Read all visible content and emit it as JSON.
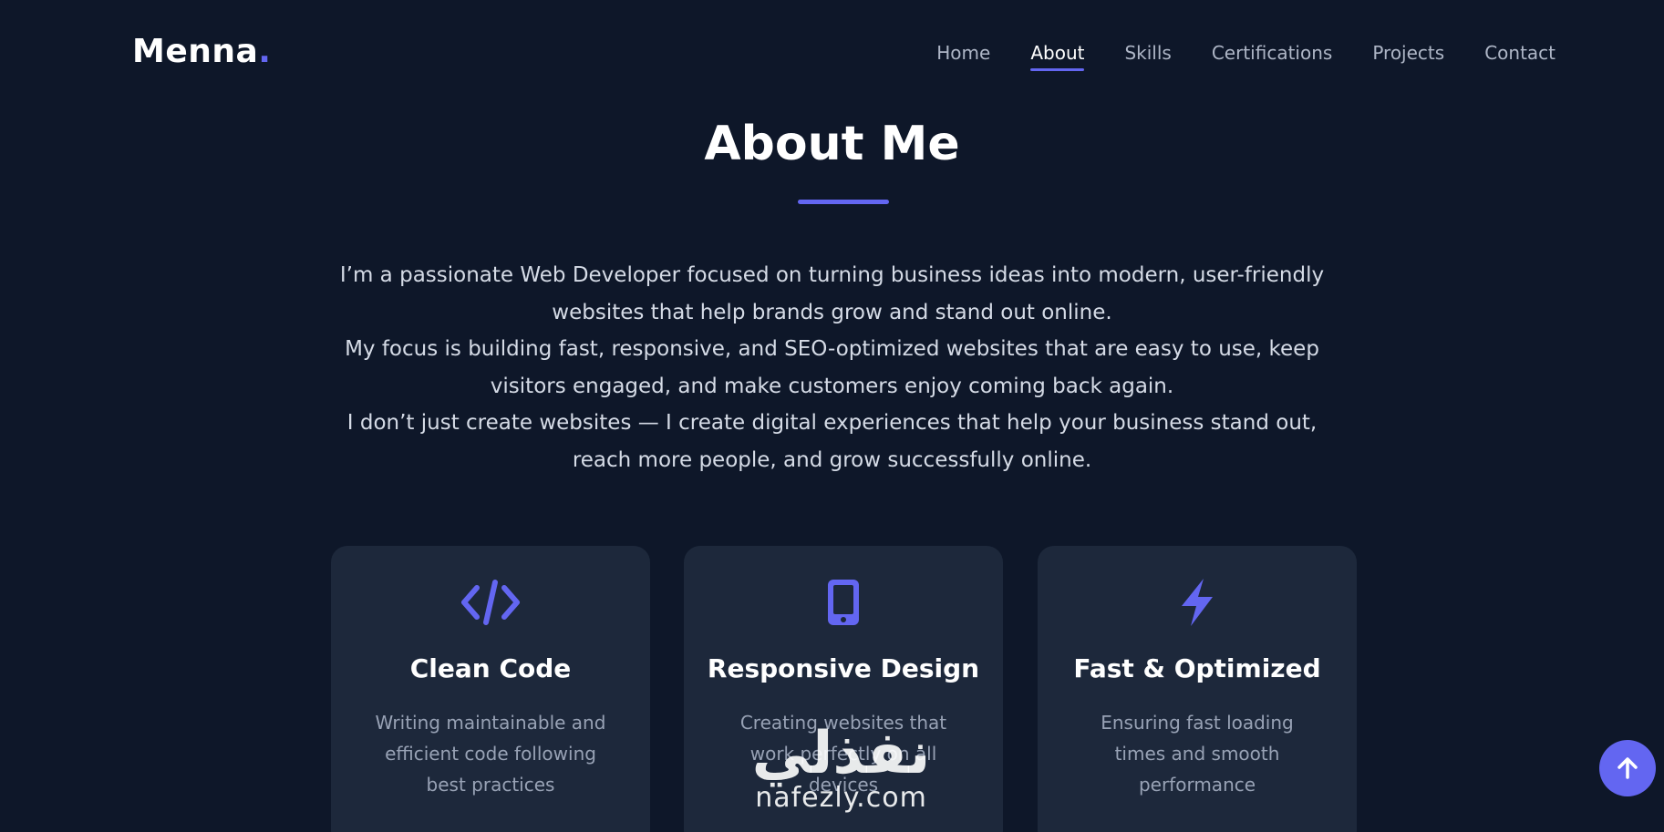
{
  "brand": {
    "name": "Menna",
    "dot": "."
  },
  "nav": {
    "items": [
      {
        "label": "Home",
        "active": false
      },
      {
        "label": "About",
        "active": true
      },
      {
        "label": "Skills",
        "active": false
      },
      {
        "label": "Certifications",
        "active": false
      },
      {
        "label": "Projects",
        "active": false
      },
      {
        "label": "Contact",
        "active": false
      }
    ]
  },
  "about": {
    "title": "About Me",
    "paragraphs": [
      "I’m a passionate Web Developer focused on turning business ideas into modern, user-friendly websites that help brands grow and stand out online.",
      "My focus is building fast, responsive, and SEO-optimized websites that are easy to use, keep visitors engaged, and make customers enjoy coming back again.",
      "I don’t just create websites — I create digital experiences that help your business stand out, reach more people, and grow successfully online."
    ],
    "cards": [
      {
        "icon": "code-icon",
        "title": "Clean Code",
        "description": "Writing maintainable and efficient code following best practices"
      },
      {
        "icon": "mobile-icon",
        "title": "Responsive Design",
        "description": "Creating websites that work perfectly on all devices"
      },
      {
        "icon": "lightning-icon",
        "title": "Fast & Optimized",
        "description": "Ensuring fast loading times and smooth performance"
      }
    ]
  },
  "watermark": {
    "arabic": "نفذلي",
    "latin": "nafezly.com"
  },
  "scroll_top": {
    "icon": "arrow-up-icon"
  },
  "colors": {
    "background": "#0e1729",
    "card": "#1d283b",
    "accent": "#6366f1",
    "text_muted": "#98a2b5"
  }
}
